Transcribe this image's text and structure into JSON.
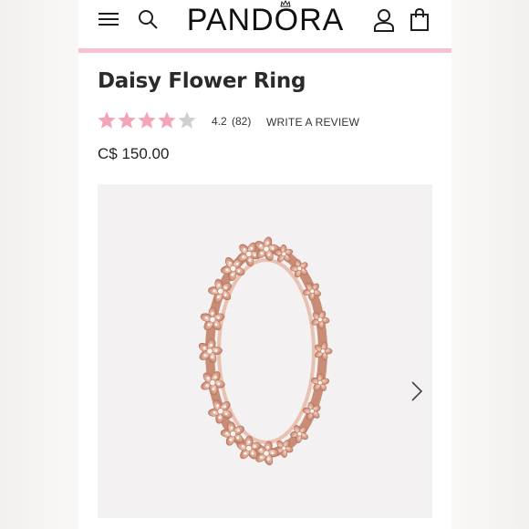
{
  "header": {
    "brand": "PANDORA",
    "icons": [
      "menu-icon",
      "search-icon",
      "user-icon",
      "shopping-bag-icon"
    ],
    "accent_color": "#f4c3cf"
  },
  "product": {
    "title": "Daisy Flower Ring",
    "rating": "4.2",
    "rating_value": 4.2,
    "rating_max": 5,
    "review_count": "(82)",
    "review_link": "WRITE A REVIEW",
    "price": "C$ 150.00"
  },
  "gallery": {
    "next_icon": "chevron-right-icon",
    "image_icon": "daisy-ring-image"
  },
  "colors": {
    "star_filled": "#f3a6b8",
    "star_empty": "#d0d0d0",
    "rose_gold": "#d9a48e"
  }
}
